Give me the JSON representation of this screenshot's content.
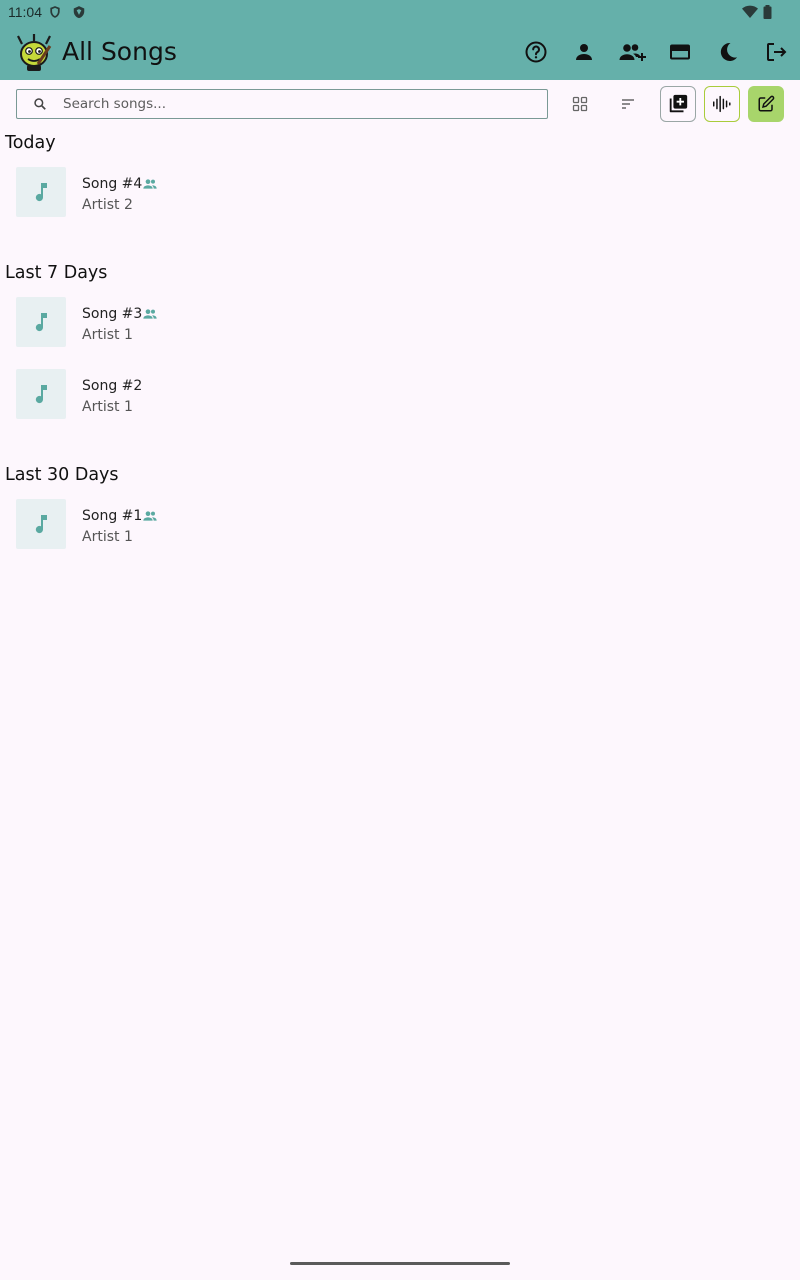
{
  "status_bar": {
    "time": "11:04",
    "icons": [
      "shield-icon",
      "vpn-shield-icon",
      "wifi-icon",
      "battery-icon"
    ]
  },
  "app_bar": {
    "title": "All Songs",
    "logo": "app-logo-icon",
    "actions": [
      "help-icon",
      "profile-icon",
      "add-collaborator-icon",
      "payment-card-icon",
      "dark-mode-icon",
      "logout-icon"
    ],
    "background": "#65b0aa"
  },
  "toolbar": {
    "search_placeholder": "Search songs...",
    "search_value": "",
    "view_toggle": "grid-view-icon",
    "sort": "sort-icon",
    "add": "add-song-icon",
    "record": "waveform-icon",
    "edit": "edit-icon"
  },
  "sections": [
    {
      "title": "Today",
      "songs": [
        {
          "title": "Song #4",
          "artist": "Artist 2",
          "shared": true
        }
      ]
    },
    {
      "title": "Last 7 Days",
      "songs": [
        {
          "title": "Song #3",
          "artist": "Artist 1",
          "shared": true
        },
        {
          "title": "Song #2",
          "artist": "Artist 1",
          "shared": false
        }
      ]
    },
    {
      "title": "Last 30 Days",
      "songs": [
        {
          "title": "Song #1",
          "artist": "Artist 1",
          "shared": true
        }
      ]
    }
  ],
  "colors": {
    "accent": "#65b0aa",
    "edit_button": "#a8d56b",
    "wave_button_border": "#a9cc3b",
    "background": "#fdf7fd"
  }
}
